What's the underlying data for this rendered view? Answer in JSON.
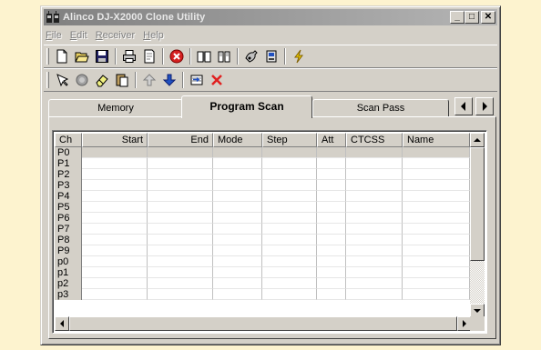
{
  "window": {
    "title": "Alinco DJ-X2000 Clone Utility",
    "minimize_label": "_",
    "maximize_label": "□",
    "close_label": "✕"
  },
  "menu": [
    "File",
    "Edit",
    "Receiver",
    "Help"
  ],
  "toolbar1": [
    "new-file-icon",
    "open-folder-icon",
    "save-icon",
    "print-icon",
    "print-preview-icon",
    "stop-icon",
    "book-open-icon",
    "book-icon",
    "connect-icon",
    "transfer-icon",
    "lightning-icon"
  ],
  "toolbar2": [
    "pointer-icon",
    "circle-gray-icon",
    "eraser-icon",
    "paste-icon",
    "arrow-up-icon",
    "arrow-down-icon",
    "insert-row-icon",
    "delete-x-icon"
  ],
  "tabs": {
    "items": [
      "Memory",
      "Program Scan",
      "Scan Pass"
    ],
    "active": "Program Scan"
  },
  "grid": {
    "columns": [
      "Ch",
      "Start",
      "End",
      "Mode",
      "Step",
      "Att",
      "CTCSS",
      "Name"
    ],
    "rows": [
      "P0",
      "P1",
      "P2",
      "P3",
      "P4",
      "P5",
      "P6",
      "P7",
      "P8",
      "P9",
      "p0",
      "p1",
      "p2",
      "p3"
    ],
    "selected_row": "P0"
  },
  "colors": {
    "background": "#fdf3cf",
    "window_face": "#d4d0c8",
    "titlebar_inactive": "#808080",
    "stop_red": "#d42020",
    "arrow_blue": "#2050c0"
  }
}
